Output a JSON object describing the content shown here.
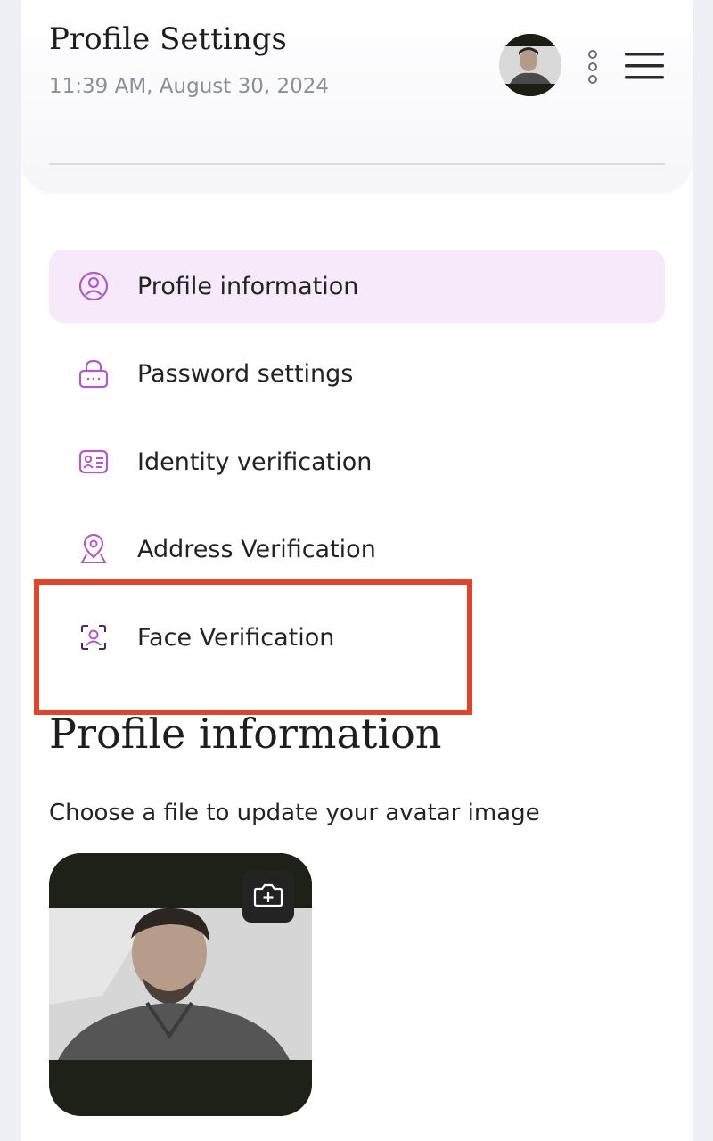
{
  "header": {
    "title": "Profile Settings",
    "timestamp": "11:39 AM, August 30, 2024",
    "avatar_icon": "user-avatar",
    "more_icon": "kebab-menu-icon",
    "menu_icon": "hamburger-menu-icon"
  },
  "menu": {
    "items": [
      {
        "label": "Profile information",
        "icon": "user-circle-icon",
        "active": true
      },
      {
        "label": "Password settings",
        "icon": "lock-icon",
        "active": false
      },
      {
        "label": "Identity verification",
        "icon": "id-card-icon",
        "active": false
      },
      {
        "label": "Address Verification",
        "icon": "map-pin-icon",
        "active": false
      },
      {
        "label": "Face Verification",
        "icon": "face-scan-icon",
        "active": false
      }
    ]
  },
  "highlighted_item": "Face Verification",
  "section": {
    "title": "Profile information",
    "description": "Choose a file to update your avatar image",
    "camera_icon": "camera-add-icon"
  },
  "colors": {
    "accent": "#b05bc8",
    "active_bg": "#f6e9fa",
    "highlight": "#e2432b"
  }
}
